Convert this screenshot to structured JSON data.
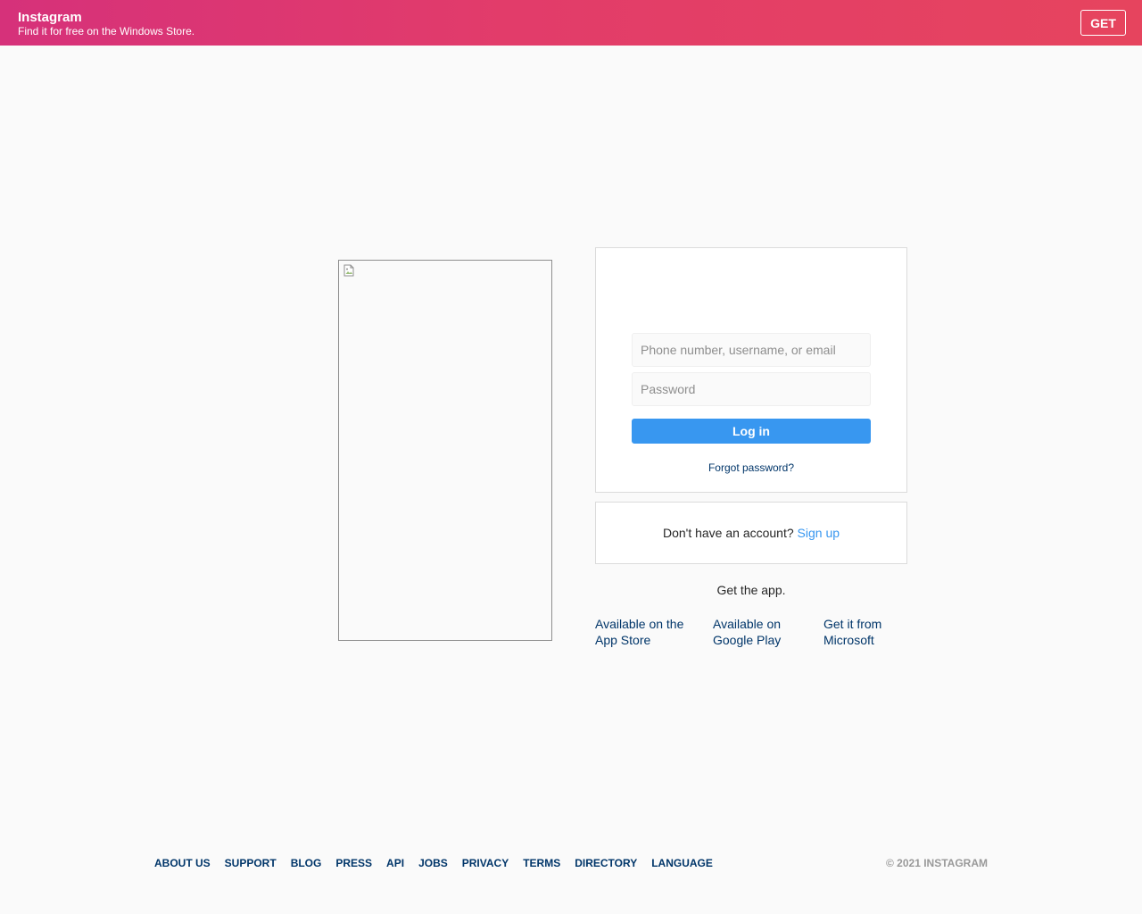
{
  "banner": {
    "title": "Instagram",
    "subtitle": "Find it for free on the Windows Store.",
    "get_label": "GET",
    "color_start": "#d6317a",
    "color_end": "#e6445e"
  },
  "phone_image": {
    "icon": "broken-image-icon"
  },
  "login": {
    "username_placeholder": "Phone number, username, or email",
    "password_placeholder": "Password",
    "login_label": "Log in",
    "forgot_label": "Forgot password?",
    "button_color": "#3897f0"
  },
  "signup": {
    "prompt": "Don't have an account?",
    "link_label": "Sign up"
  },
  "app": {
    "get_app_label": "Get the app.",
    "stores": [
      {
        "line1": "Available on the",
        "line2": "App Store"
      },
      {
        "line1": "Available on",
        "line2": "Google Play"
      },
      {
        "line1": "Get it from",
        "line2": "Microsoft"
      }
    ]
  },
  "footer": {
    "links": [
      "About us",
      "Support",
      "Blog",
      "Press",
      "API",
      "Jobs",
      "Privacy",
      "Terms",
      "Directory",
      "Language"
    ],
    "copyright": "© 2021 Instagram"
  }
}
